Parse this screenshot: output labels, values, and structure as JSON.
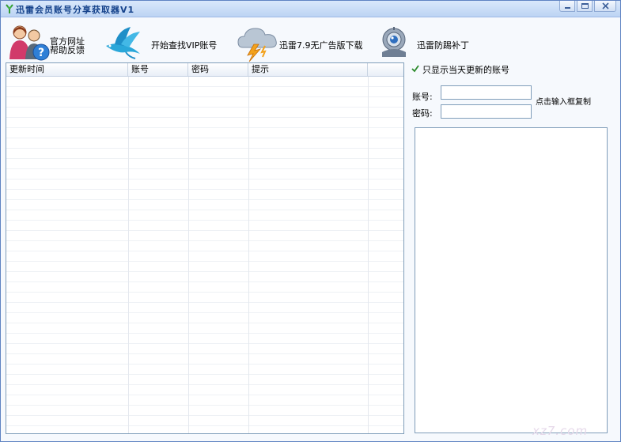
{
  "window": {
    "title": "迅雷会员账号分享获取器V1"
  },
  "toolbar": {
    "items": [
      {
        "label_line1": "官方网址",
        "label_line2": "帮助反馈",
        "icon": "users-help-icon"
      },
      {
        "label": "开始查找VIP账号",
        "icon": "hummingbird-icon"
      },
      {
        "label": "迅雷7.9无广告版下载",
        "icon": "thunder-cloud-icon"
      },
      {
        "label": "迅雷防踢补丁",
        "icon": "lock-robot-icon"
      }
    ]
  },
  "table": {
    "columns": [
      "更新时间",
      "账号",
      "密码",
      "提示",
      ""
    ],
    "rows": []
  },
  "options": {
    "show_today_label": "只显示当天更新的账号",
    "show_today_checked": true
  },
  "form": {
    "account_label": "账号:",
    "password_label": "密码:",
    "account_value": "",
    "password_value": "",
    "hint": "点击输入框复制"
  },
  "watermark": "xz7.com",
  "colors": {
    "title_text": "#15428b",
    "border": "#7f9db9",
    "check": "#2b8a2b"
  }
}
